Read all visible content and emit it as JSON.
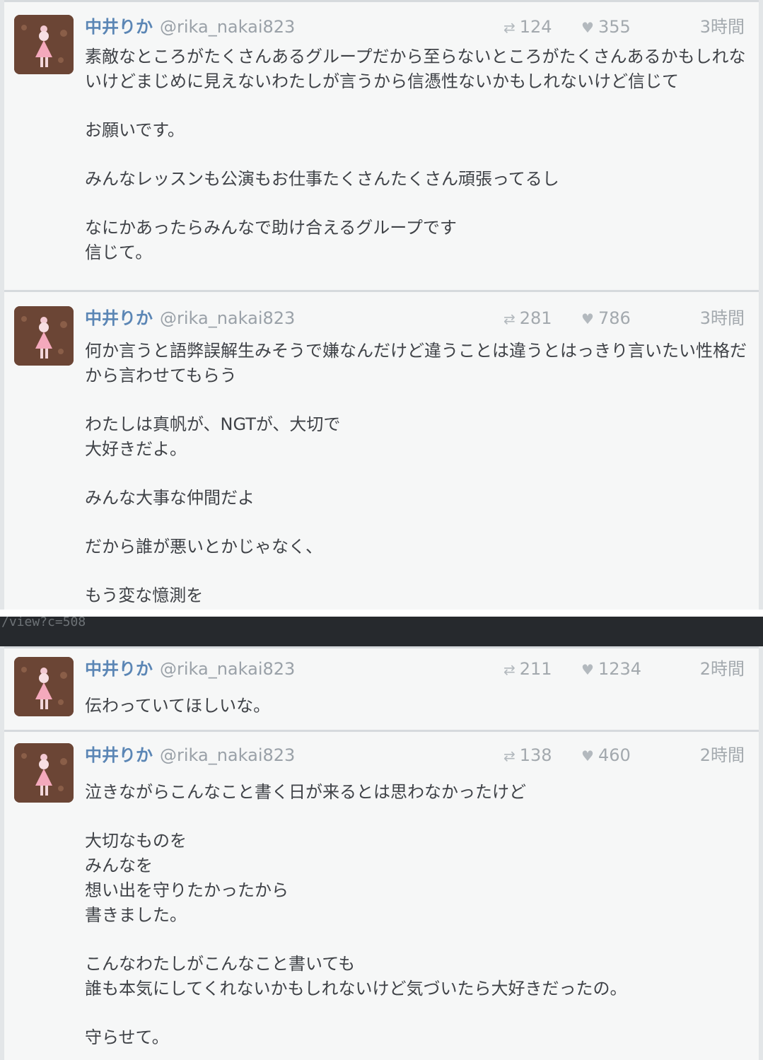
{
  "url_fragment": "/view?c=508",
  "tweets": [
    {
      "name": "中井りか",
      "handle": "@rika_nakai823",
      "retweets": "124",
      "likes": "355",
      "time": "3時間",
      "paragraphs": [
        "素敵なところがたくさんあるグループだから至らないところがたくさんあるかもしれないけどまじめに見えないわたしが言うから信憑性ないかもしれないけど信じて",
        "お願いです。",
        "みんなレッスンも公演もお仕事たくさんたくさん頑張ってるし",
        "なにかあったらみんなで助け合えるグループです\n信じて。"
      ]
    },
    {
      "name": "中井りか",
      "handle": "@rika_nakai823",
      "retweets": "281",
      "likes": "786",
      "time": "3時間",
      "paragraphs": [
        "何か言うと語弊誤解生みそうで嫌なんだけど違うことは違うとはっきり言いたい性格だから言わせてもらう",
        "わたしは真帆が、NGTが、大切で\n大好きだよ。",
        "みんな大事な仲間だよ",
        "だから誰が悪いとかじゃなく、",
        "もう変な憶測を"
      ]
    },
    {
      "name": "中井りか",
      "handle": "@rika_nakai823",
      "retweets": "211",
      "likes": "1234",
      "time": "2時間",
      "paragraphs": [
        "伝わっていてほしいな。"
      ]
    },
    {
      "name": "中井りか",
      "handle": "@rika_nakai823",
      "retweets": "138",
      "likes": "460",
      "time": "2時間",
      "paragraphs": [
        "泣きながらこんなこと書く日が来るとは思わなかったけど",
        "大切なものを\nみんなを\n想い出を守りたかったから\n書きました。",
        "こんなわたしがこんなこと書いても\n誰も本気にしてくれないかもしれないけど気づいたら大好きだったの。",
        "守らせて。"
      ]
    }
  ]
}
